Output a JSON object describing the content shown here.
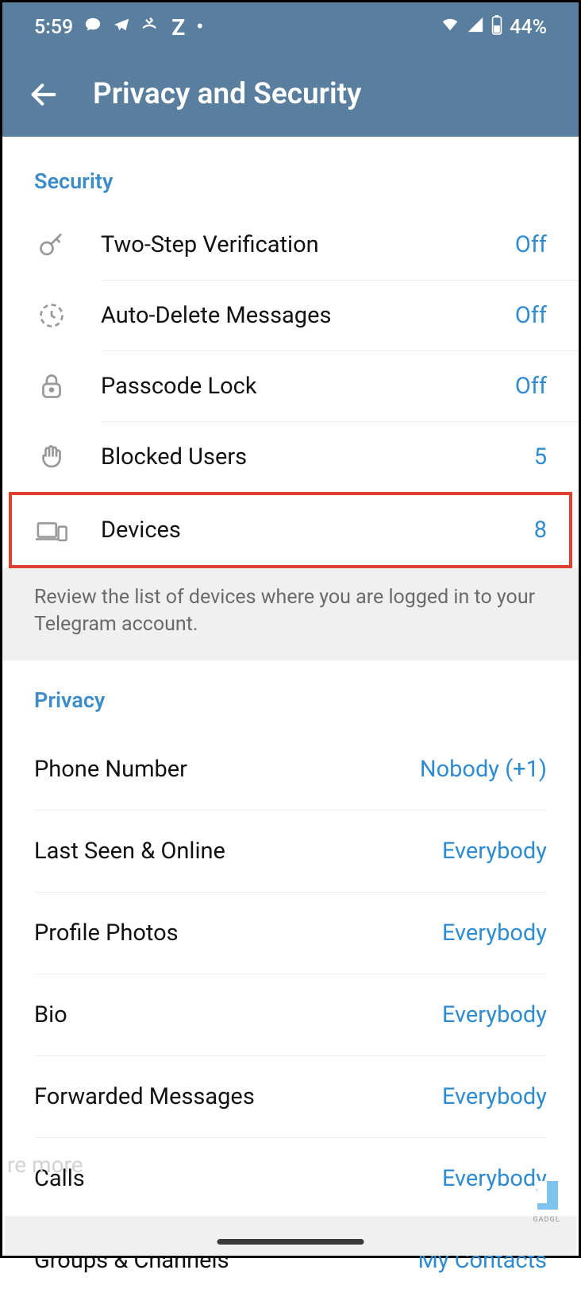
{
  "status_bar": {
    "time": "5:59",
    "battery_pct": "44%"
  },
  "header": {
    "title": "Privacy and Security"
  },
  "security": {
    "title": "Security",
    "items": [
      {
        "label": "Two-Step Verification",
        "value": "Off"
      },
      {
        "label": "Auto-Delete Messages",
        "value": "Off"
      },
      {
        "label": "Passcode Lock",
        "value": "Off"
      },
      {
        "label": "Blocked Users",
        "value": "5"
      },
      {
        "label": "Devices",
        "value": "8"
      }
    ],
    "footer": "Review the list of devices where you are logged in to your Telegram account."
  },
  "privacy": {
    "title": "Privacy",
    "items": [
      {
        "label": "Phone Number",
        "value": "Nobody (+1)"
      },
      {
        "label": "Last Seen & Online",
        "value": "Everybody"
      },
      {
        "label": "Profile Photos",
        "value": "Everybody"
      },
      {
        "label": "Bio",
        "value": "Everybody"
      },
      {
        "label": "Forwarded Messages",
        "value": "Everybody"
      },
      {
        "label": "Calls",
        "value": "Everybody"
      },
      {
        "label": "Groups & Channels",
        "value": "My Contacts"
      }
    ]
  },
  "misc": {
    "faded_text": "re more",
    "watermark_text": "GADGL"
  }
}
